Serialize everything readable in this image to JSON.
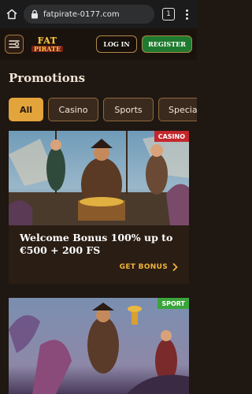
{
  "browser": {
    "url": "fatpirate-0177.com",
    "tab_count": "1",
    "icons": [
      "home-icon",
      "lock-icon",
      "tabs-icon",
      "more-icon"
    ]
  },
  "header": {
    "logo_top": "FAT",
    "logo_bottom": "PIRATE",
    "login_label": "LOG IN",
    "register_label": "REGISTER"
  },
  "page": {
    "title": "Promotions"
  },
  "filters": [
    {
      "label": "All",
      "active": true
    },
    {
      "label": "Casino",
      "active": false
    },
    {
      "label": "Sports",
      "active": false
    },
    {
      "label": "Specia",
      "active": false
    }
  ],
  "cards": [
    {
      "badge": "CASINO",
      "title": "Welcome Bonus 100% up to €500 + 200 FS",
      "cta": "GET BONUS"
    },
    {
      "badge": "SPORT"
    }
  ],
  "colors": {
    "background": "#1f1712",
    "accent": "#e2a43b",
    "register": "#1e7a2e",
    "casino_badge": "#c2272d",
    "sport_badge": "#3aa63a"
  }
}
